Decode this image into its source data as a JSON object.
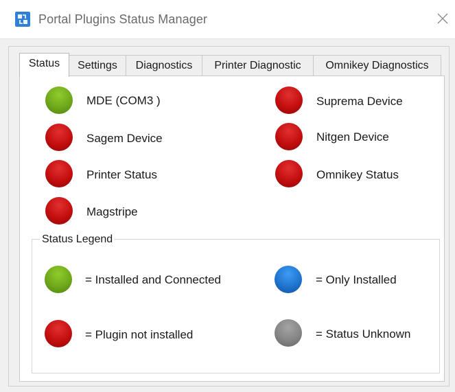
{
  "window": {
    "title": "Portal Plugins Status Manager",
    "app_icon": "plugin-app-icon",
    "close_icon": "close-x-icon"
  },
  "tabs": [
    {
      "label": "Status",
      "active": true
    },
    {
      "label": "Settings",
      "active": false
    },
    {
      "label": "Diagnostics",
      "active": false
    },
    {
      "label": "Printer Diagnostic",
      "active": false
    },
    {
      "label": "Omnikey Diagnostics",
      "active": false
    }
  ],
  "devices": [
    {
      "label": "MDE (COM3 )",
      "status": "green"
    },
    {
      "label": "Suprema Device",
      "status": "red"
    },
    {
      "label": "Sagem Device",
      "status": "red"
    },
    {
      "label": "Nitgen Device",
      "status": "red"
    },
    {
      "label": "Printer Status",
      "status": "red"
    },
    {
      "label": "Omnikey Status",
      "status": "red"
    },
    {
      "label": "Magstripe",
      "status": "red"
    }
  ],
  "legend": {
    "title": "Status Legend",
    "items": [
      {
        "label": "= Installed and Connected",
        "color": "green"
      },
      {
        "label": "= Only Installed",
        "color": "blue"
      },
      {
        "label": "= Plugin not installed",
        "color": "red"
      },
      {
        "label": "= Status Unknown",
        "color": "gray"
      }
    ]
  },
  "colors": {
    "green": "#6fa81a",
    "red": "#c40e0e",
    "blue": "#1f74cf",
    "gray": "#858585"
  }
}
